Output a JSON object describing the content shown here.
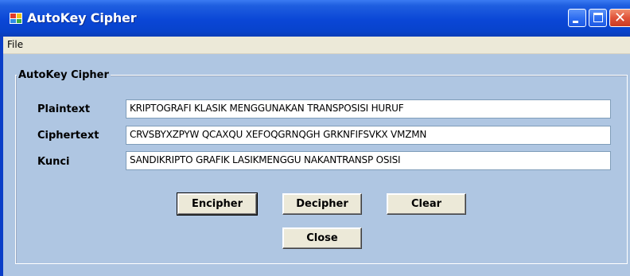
{
  "window": {
    "title": "AutoKey Cipher",
    "icon": "app-icon"
  },
  "title_buttons": {
    "minimize": "minimize-icon",
    "maximize": "maximize-icon",
    "close": "close-icon"
  },
  "menu": {
    "items": [
      "File"
    ]
  },
  "group": {
    "legend": "AutoKey Cipher"
  },
  "fields": [
    {
      "label": "Plaintext",
      "value": "KRIPTOGRAFI KLASIK MENGGUNAKAN TRANSPOSISI HURUF"
    },
    {
      "label": "Ciphertext",
      "value": "CRVSBYXZPYW QCAXQU XEFOQGRNQGH GRKNFIFSVKX VMZMN"
    },
    {
      "label": "Kunci",
      "value": "SANDIKRIPTO GRAFIK LASIKMENGGU NAKANTRANSP OSISI"
    }
  ],
  "buttons": {
    "encipher": "Encipher",
    "decipher": "Decipher",
    "clear": "Clear",
    "close": "Close"
  }
}
